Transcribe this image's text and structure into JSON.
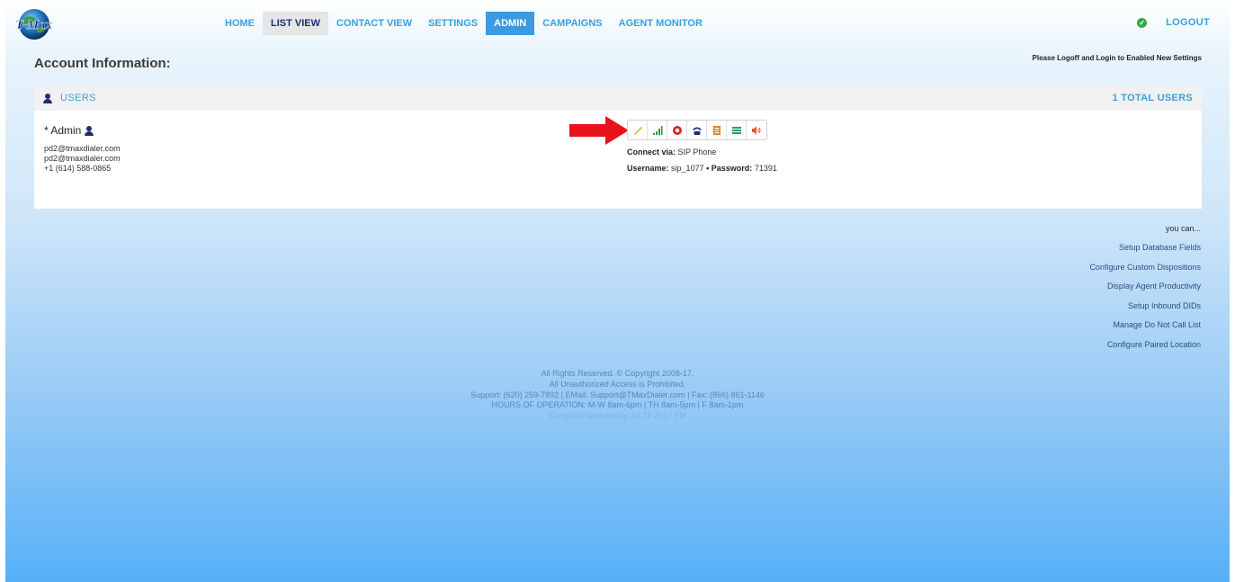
{
  "logo": {
    "text": "T-Max"
  },
  "nav": {
    "items": [
      {
        "label": "HOME",
        "state": "normal"
      },
      {
        "label": "LIST VIEW",
        "state": "selected"
      },
      {
        "label": "CONTACT VIEW",
        "state": "normal"
      },
      {
        "label": "SETTINGS",
        "state": "normal"
      },
      {
        "label": "ADMIN",
        "state": "active"
      },
      {
        "label": "CAMPAIGNS",
        "state": "normal"
      },
      {
        "label": "AGENT MONITOR",
        "state": "normal"
      }
    ],
    "logout": "LOGOUT"
  },
  "page": {
    "title": "Account Information:",
    "notice": "Please Logoff and Login to Enabled New Settings"
  },
  "users_panel": {
    "title": "USERS",
    "total": "1 TOTAL USERS",
    "user": {
      "name": "* Admin",
      "email_1": "pd2@tmaxdialer.com",
      "email_2": "pd2@tmaxdialer.com",
      "phone": "+1 (614) 588-0865"
    },
    "tools": [
      "pencil-icon",
      "signal-icon",
      "stop-icon",
      "phone-icon",
      "book-icon",
      "list-icon",
      "speaker-icon"
    ],
    "connect_label": "Connect via:",
    "connect_value": "SIP Phone",
    "username_label": "Username:",
    "username_value": "sip_1077",
    "separator": "•",
    "password_label": "Password:",
    "password_value": "71391"
  },
  "links": {
    "lead": "you can...",
    "items": [
      "Setup Database Fields",
      "Configure Custom Dispositions",
      "Display Agent Productivity",
      "Setup Inbound DIDs",
      "Manage Do Not Call List",
      "Configure Paired Location"
    ]
  },
  "footer": {
    "line1": "All Rights Reserved. © Copyright 2008-17.",
    "line2": "All Unauthorized Access is Prohibited.",
    "line3": "Support: (620) 259-7892 | EMail: Support@TMaxDialer.com | Fax: (866) 861-1146",
    "line4": "HOURS OF OPERATION: M-W 8am-6pm | TH 8am-5pm | F 8am-1pm",
    "line5": "Compiled Wednesday Jul 19 2017 PM"
  },
  "colors": {
    "accent": "#39a0dc",
    "nav_active": "#3a9be0",
    "arrow": "#e8121b",
    "user_icon": "#1f2d6e"
  }
}
